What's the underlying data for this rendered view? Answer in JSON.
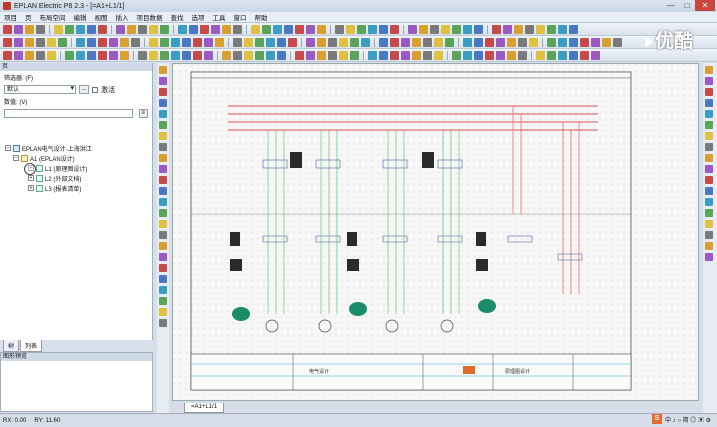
{
  "window": {
    "title": "EPLAN Electric P8 2.3 - [=A1+L1/1]",
    "min_label": "—",
    "max_label": "□",
    "close_label": "✕"
  },
  "menu": [
    "项目",
    "页",
    "布局空间",
    "编辑",
    "视图",
    "插入",
    "项目数据",
    "查找",
    "选项",
    "工具",
    "窗口",
    "帮助"
  ],
  "left_panel": {
    "header": "页",
    "filter_label": "筛选器: (F)",
    "filter_value": "默认",
    "filter_button": "...",
    "activate_label": "激活",
    "value_label": "数值: (V)",
    "value_button": "≡",
    "tree": [
      {
        "level": 0,
        "expander": "−",
        "label": "EPLAN电气设计-上海洪江"
      },
      {
        "level": 1,
        "expander": "−",
        "label": "A1 (EPLAN设计)"
      },
      {
        "level": 2,
        "expander": "+",
        "label": "L1 (原理图设计)"
      },
      {
        "level": 2,
        "expander": "+",
        "label": "L2 (外部文档)"
      },
      {
        "level": 2,
        "expander": "+",
        "label": "L3 (报表清单)"
      }
    ],
    "tabs": [
      "树",
      "列表"
    ]
  },
  "graphic_panel": {
    "header": "图形预览"
  },
  "page_tab": "=A1+L1/1",
  "status": {
    "rx": "RX: 0.00",
    "ry": "RY: 11.60"
  },
  "watermark": "优酷",
  "tray": {
    "sogou": "S",
    "ime": "中 ♪ ○ 简 ◎ ▣ ⚙"
  },
  "title_block": {
    "project_title": "电气设计",
    "page_desc": "原理图设计"
  }
}
